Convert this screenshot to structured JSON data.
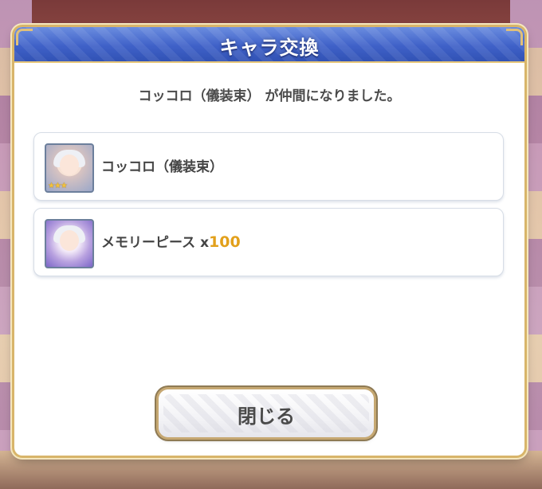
{
  "dialog": {
    "title": "キャラ交換",
    "message": "コッコロ（儀装束） が仲間になりました。"
  },
  "items": [
    {
      "name": "コッコロ（儀装束）",
      "icon": "character-portrait-icon",
      "stars": "★★★"
    },
    {
      "name": "メモリーピース ",
      "quantity_prefix": "x",
      "quantity": "100",
      "icon": "memory-piece-icon"
    }
  ],
  "buttons": {
    "close_label": "閉じる"
  },
  "colors": {
    "title_bar": "#3f61c8",
    "frame_gold": "#d8b56a",
    "quantity": "#e2a01b"
  }
}
